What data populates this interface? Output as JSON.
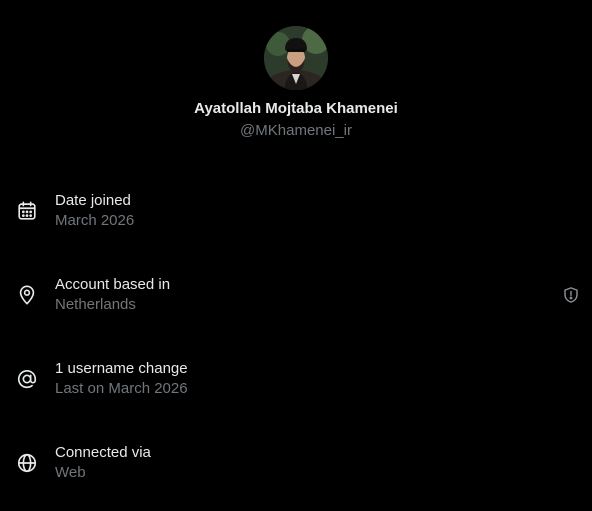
{
  "profile": {
    "display_name": "Ayatollah Mojtaba Khamenei",
    "handle": "@MKhamenei_ir"
  },
  "rows": [
    {
      "icon": "calendar-icon",
      "title": "Date joined",
      "value": "March 2026"
    },
    {
      "icon": "location-pin-icon",
      "title": "Account based in",
      "value": "Netherlands",
      "trailing_icon": "shield-alert-icon"
    },
    {
      "icon": "at-sign-icon",
      "title": "1 username change",
      "value": "Last on March 2026"
    },
    {
      "icon": "globe-icon",
      "title": "Connected via",
      "value": "Web"
    }
  ],
  "colors": {
    "background": "#000000",
    "primary_text": "#e7e9ea",
    "secondary_text": "#71767b"
  }
}
